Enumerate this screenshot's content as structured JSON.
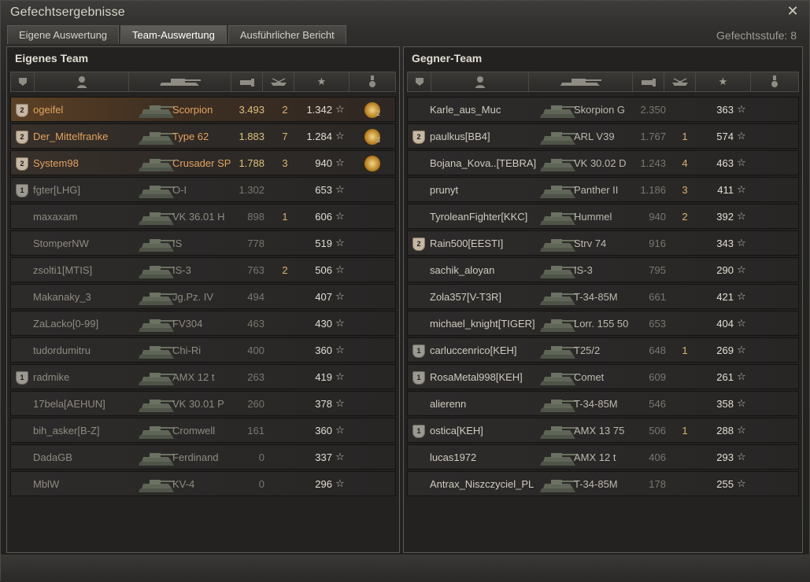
{
  "window": {
    "title": "Gefechtsergebnisse",
    "close_symbol": "✕"
  },
  "tabs": [
    {
      "label": "Eigene Auswertung",
      "active": false
    },
    {
      "label": "Team-Auswertung",
      "active": true
    },
    {
      "label": "Ausführlicher Bericht",
      "active": false
    }
  ],
  "battle_tier": "Gefechtsstufe: 8",
  "colors": {
    "accent_orange": "#e3a35f",
    "gold": "#e0c07e",
    "kills_yellow": "#d9b56d"
  },
  "own_team": {
    "title": "Eigenes Team",
    "header_icons": [
      "platoon-icon",
      "player-icon",
      "tank-icon",
      "damage-icon",
      "kills-icon",
      "xp-star-icon",
      "medal-icon"
    ],
    "players": [
      {
        "status": "me",
        "badge": "2",
        "badge_type": "squad",
        "name": "ogeifel",
        "tank": "Scorpion",
        "damage": "3.493",
        "kills": "2",
        "xp": "1.342",
        "medal": true,
        "medal_count": "2"
      },
      {
        "status": "squad",
        "badge": "2",
        "badge_type": "squad",
        "name": "Der_Mittelfranke",
        "tank": "Type 62",
        "damage": "1.883",
        "kills": "7",
        "xp": "1.284",
        "medal": true,
        "medal_count": "3"
      },
      {
        "status": "squad",
        "badge": "2",
        "badge_type": "squad",
        "name": "System98",
        "tank": "Crusader SP",
        "damage": "1.788",
        "kills": "3",
        "xp": "940",
        "medal": true,
        "medal_count": ""
      },
      {
        "status": "dead",
        "badge": "1",
        "badge_type": "plat",
        "name": "fgter[LHG]",
        "tank": "O-I",
        "damage": "1.302",
        "kills": "",
        "xp": "653",
        "medal": false,
        "medal_count": ""
      },
      {
        "status": "dead",
        "badge": "",
        "badge_type": "",
        "name": "maxaxam",
        "tank": "VK 36.01 H",
        "damage": "898",
        "kills": "1",
        "xp": "606",
        "medal": false,
        "medal_count": ""
      },
      {
        "status": "dead",
        "badge": "",
        "badge_type": "",
        "name": "StomperNW",
        "tank": "IS",
        "damage": "778",
        "kills": "",
        "xp": "519",
        "medal": false,
        "medal_count": ""
      },
      {
        "status": "dead",
        "badge": "",
        "badge_type": "",
        "name": "zsolti1[MTIS]",
        "tank": "IS-3",
        "damage": "763",
        "kills": "2",
        "xp": "506",
        "medal": false,
        "medal_count": ""
      },
      {
        "status": "dead",
        "badge": "",
        "badge_type": "",
        "name": "Makanaky_3",
        "tank": "Jg.Pz. IV",
        "damage": "494",
        "kills": "",
        "xp": "407",
        "medal": false,
        "medal_count": ""
      },
      {
        "status": "dead",
        "badge": "",
        "badge_type": "",
        "name": "ZaLacko[0-99]",
        "tank": "FV304",
        "damage": "463",
        "kills": "",
        "xp": "430",
        "medal": false,
        "medal_count": ""
      },
      {
        "status": "dead",
        "badge": "",
        "badge_type": "",
        "name": "tudordumitru",
        "tank": "Chi-Ri",
        "damage": "400",
        "kills": "",
        "xp": "360",
        "medal": false,
        "medal_count": ""
      },
      {
        "status": "dead",
        "badge": "1",
        "badge_type": "plat",
        "name": "radmike",
        "tank": "AMX 12 t",
        "damage": "263",
        "kills": "",
        "xp": "419",
        "medal": false,
        "medal_count": ""
      },
      {
        "status": "dead",
        "badge": "",
        "badge_type": "",
        "name": "17bela[AEHUN]",
        "tank": "VK 30.01 P",
        "damage": "260",
        "kills": "",
        "xp": "378",
        "medal": false,
        "medal_count": ""
      },
      {
        "status": "dead",
        "badge": "",
        "badge_type": "",
        "name": "bih_asker[B-Z]",
        "tank": "Cromwell",
        "damage": "161",
        "kills": "",
        "xp": "360",
        "medal": false,
        "medal_count": ""
      },
      {
        "status": "dead",
        "badge": "",
        "badge_type": "",
        "name": "DadaGB",
        "tank": "Ferdinand",
        "damage": "0",
        "kills": "",
        "xp": "337",
        "medal": false,
        "medal_count": ""
      },
      {
        "status": "dead",
        "badge": "",
        "badge_type": "",
        "name": "MblW",
        "tank": "KV-4",
        "damage": "0",
        "kills": "",
        "xp": "296",
        "medal": false,
        "medal_count": ""
      }
    ]
  },
  "enemy_team": {
    "title": "Gegner-Team",
    "header_icons": [
      "platoon-icon",
      "player-icon",
      "tank-icon",
      "damage-icon",
      "kills-icon",
      "xp-star-icon",
      "medal-icon"
    ],
    "players": [
      {
        "status": "alive",
        "badge": "",
        "badge_type": "",
        "name": "Karle_aus_Muc",
        "tank": "Skorpion G",
        "damage": "2.350",
        "kills": "",
        "xp": "363",
        "medal": false,
        "medal_count": ""
      },
      {
        "status": "alive",
        "badge": "2",
        "badge_type": "squad",
        "name": "paulkus[BB4]",
        "tank": "ARL V39",
        "damage": "1.767",
        "kills": "1",
        "xp": "574",
        "medal": false,
        "medal_count": ""
      },
      {
        "status": "alive",
        "badge": "",
        "badge_type": "",
        "name": "Bojana_Kova..[TEBRA]",
        "tank": "VK 30.02 D",
        "damage": "1.243",
        "kills": "4",
        "xp": "463",
        "medal": false,
        "medal_count": ""
      },
      {
        "status": "alive",
        "badge": "",
        "badge_type": "",
        "name": "prunyt",
        "tank": "Panther II",
        "damage": "1.186",
        "kills": "3",
        "xp": "411",
        "medal": false,
        "medal_count": ""
      },
      {
        "status": "alive",
        "badge": "",
        "badge_type": "",
        "name": "TyroleanFighter[KKC]",
        "tank": "Hummel",
        "damage": "940",
        "kills": "2",
        "xp": "392",
        "medal": false,
        "medal_count": ""
      },
      {
        "status": "alive",
        "badge": "2",
        "badge_type": "squad",
        "name": "Rain500[EESTI]",
        "tank": "Strv 74",
        "damage": "916",
        "kills": "",
        "xp": "343",
        "medal": false,
        "medal_count": ""
      },
      {
        "status": "alive",
        "badge": "",
        "badge_type": "",
        "name": "sachik_aloyan",
        "tank": "IS-3",
        "damage": "795",
        "kills": "",
        "xp": "290",
        "medal": false,
        "medal_count": ""
      },
      {
        "status": "alive",
        "badge": "",
        "badge_type": "",
        "name": "Zola357[V-T3R]",
        "tank": "T-34-85M",
        "damage": "661",
        "kills": "",
        "xp": "421",
        "medal": false,
        "medal_count": ""
      },
      {
        "status": "alive",
        "badge": "",
        "badge_type": "",
        "name": "michael_knight[TIGER]",
        "tank": "Lorr. 155 50",
        "damage": "653",
        "kills": "",
        "xp": "404",
        "medal": false,
        "medal_count": ""
      },
      {
        "status": "alive",
        "badge": "1",
        "badge_type": "plat",
        "name": "carluccenrico[KEH]",
        "tank": "T25/2",
        "damage": "648",
        "kills": "1",
        "xp": "269",
        "medal": false,
        "medal_count": ""
      },
      {
        "status": "alive",
        "badge": "1",
        "badge_type": "plat",
        "name": "RosaMetal998[KEH]",
        "tank": "Comet",
        "damage": "609",
        "kills": "",
        "xp": "261",
        "medal": false,
        "medal_count": ""
      },
      {
        "status": "alive",
        "badge": "",
        "badge_type": "",
        "name": "alierenn",
        "tank": "T-34-85M",
        "damage": "546",
        "kills": "",
        "xp": "358",
        "medal": false,
        "medal_count": ""
      },
      {
        "status": "alive",
        "badge": "1",
        "badge_type": "plat",
        "name": "ostica[KEH]",
        "tank": "AMX 13 75",
        "damage": "506",
        "kills": "1",
        "xp": "288",
        "medal": false,
        "medal_count": ""
      },
      {
        "status": "alive",
        "badge": "",
        "badge_type": "",
        "name": "lucas1972",
        "tank": "AMX 12 t",
        "damage": "406",
        "kills": "",
        "xp": "293",
        "medal": false,
        "medal_count": ""
      },
      {
        "status": "alive",
        "badge": "",
        "badge_type": "",
        "name": "Antrax_Niszczyciel_PL",
        "tank": "T-34-85M",
        "damage": "178",
        "kills": "",
        "xp": "255",
        "medal": false,
        "medal_count": ""
      }
    ]
  }
}
